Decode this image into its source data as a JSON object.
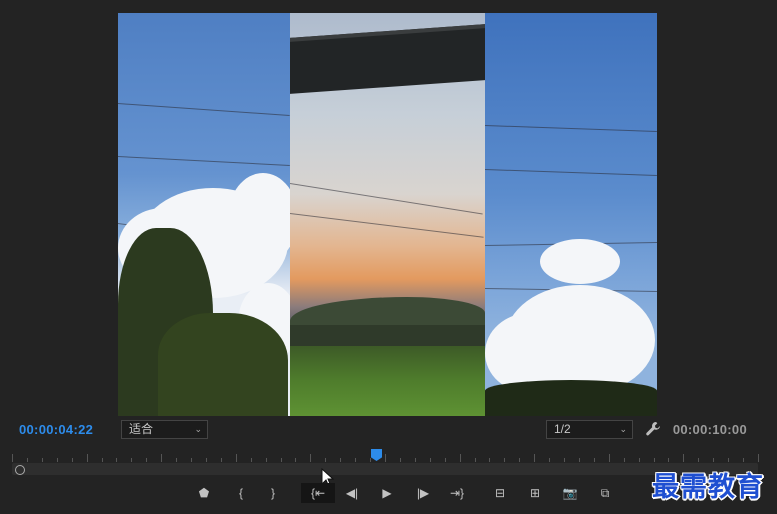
{
  "monitor": {
    "current_time": "00:00:04:22",
    "duration": "00:00:10:00",
    "zoom_select": "适合",
    "resolution_select": "1/2"
  },
  "transport": {
    "buttons": [
      {
        "name": "add-marker-button",
        "icon": "marker-icon",
        "glyph": "⬟"
      },
      {
        "name": "mark-in-button",
        "icon": "mark-in-icon",
        "glyph": "{"
      },
      {
        "name": "mark-out-button",
        "icon": "mark-out-icon",
        "glyph": "}"
      },
      {
        "name": "go-to-in-button",
        "icon": "go-to-in-icon",
        "glyph": "{⇤"
      },
      {
        "name": "step-back-button",
        "icon": "step-back-icon",
        "glyph": "◀|"
      },
      {
        "name": "play-button",
        "icon": "play-icon",
        "glyph": "▶"
      },
      {
        "name": "step-forward-button",
        "icon": "step-forward-icon",
        "glyph": "|▶"
      },
      {
        "name": "go-to-out-button",
        "icon": "go-to-out-icon",
        "glyph": "⇥}"
      },
      {
        "name": "lift-button",
        "icon": "lift-icon",
        "glyph": "⊟"
      },
      {
        "name": "extract-button",
        "icon": "extract-icon",
        "glyph": "⊞"
      },
      {
        "name": "export-frame-button",
        "icon": "camera-icon",
        "glyph": "📷"
      },
      {
        "name": "comparison-view-button",
        "icon": "comparison-view-icon",
        "glyph": "⧉"
      }
    ]
  },
  "playhead_position_fraction": 0.49,
  "watermark": "最需教育",
  "colors": {
    "accent": "#2d8ceb",
    "background": "#232323"
  }
}
